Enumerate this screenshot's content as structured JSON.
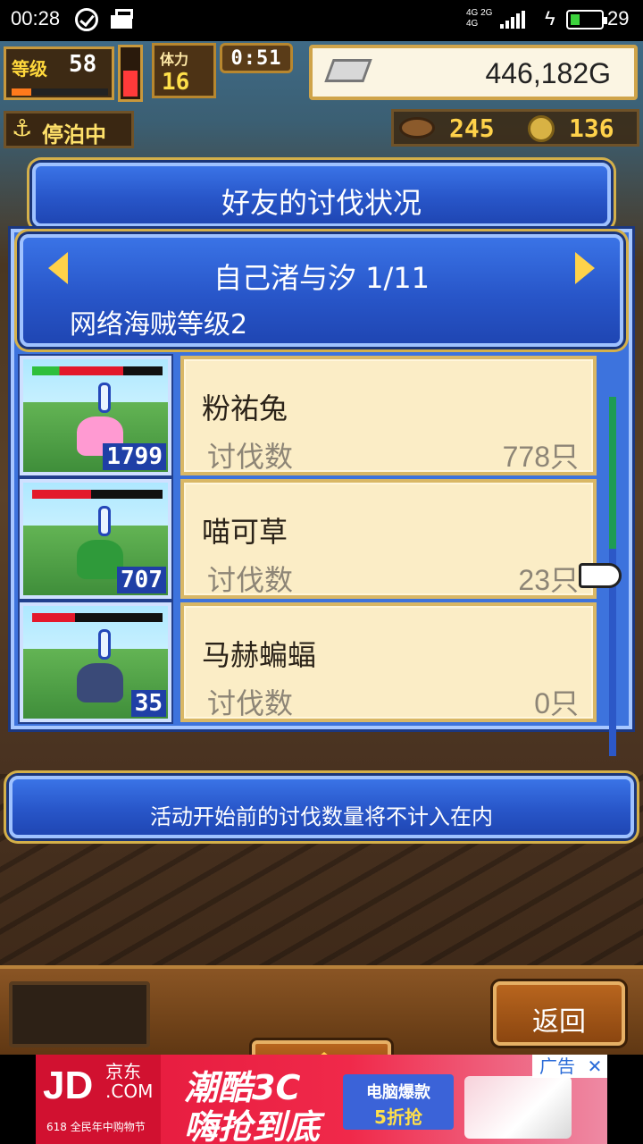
{
  "status_bar": {
    "time": "00:28",
    "network_top": "4G 2G",
    "network_bottom": "4G",
    "battery": "29",
    "charging_glyph": "ϟ"
  },
  "hud": {
    "level_label": "等级",
    "level": "58",
    "level_progress": 0.2,
    "hp_fill": 0.55,
    "stamina_label": "体力",
    "stamina": "16",
    "timer": "0:51",
    "money": "446,182G",
    "money_icon": "silver-bar-icon",
    "anchored_label": "停泊中",
    "anchor_glyph": "⚓",
    "wood": "245",
    "medals": "136"
  },
  "dialog": {
    "title": "好友的讨伐状况",
    "friend_name": "自己渚与汐 1/11",
    "pirate_level": "网络海贼等级2",
    "kills_label": "讨伐数",
    "monsters": [
      {
        "name": "粉祐兔",
        "kills": "778只",
        "count_badge": "1799",
        "hp": 0.7,
        "hp_colors": [
          "#2fbf3b",
          "#e3192b"
        ],
        "color": "#ff9ad2"
      },
      {
        "name": "喵可草",
        "kills": "23只",
        "count_badge": "707",
        "hp": 0.45,
        "hp_colors": [
          "#e3192b",
          "#e3192b"
        ],
        "color": "#2f9a3a"
      },
      {
        "name": "马赫蝙蝠",
        "kills": "0只",
        "count_badge": "35",
        "hp": 0.33,
        "hp_colors": [
          "#e3192b",
          "#e3192b"
        ],
        "color": "#3a4a78"
      }
    ],
    "notice": "活动开始前的讨伐数量将不计入在内"
  },
  "bottom": {
    "back_label": "返回",
    "up_icon": "up-arrow-icon"
  },
  "ad": {
    "logo": "JD",
    "logo_sub": "京东\n.COM",
    "logo_tag": "618 全民年中购物节",
    "slogan_1": "潮酷3C",
    "slogan_2": "嗨抢到底",
    "deal_1": "电脑爆款",
    "deal_2": "5折抢",
    "ad_tag": "广告",
    "close": "✕"
  }
}
